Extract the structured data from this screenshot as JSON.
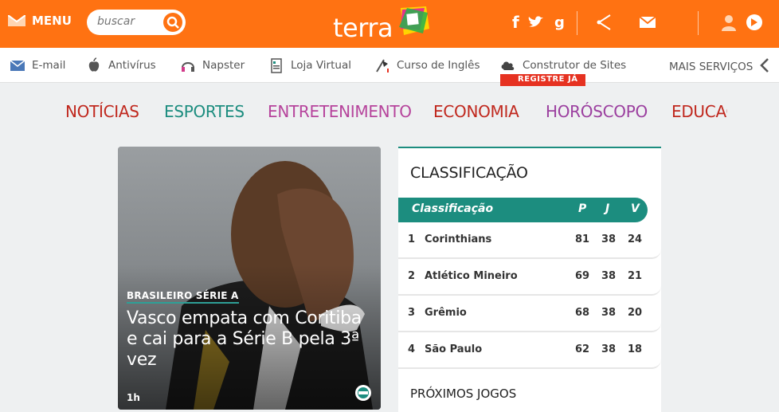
{
  "header": {
    "menu_label": "MENU",
    "search_placeholder": "buscar",
    "logo_text": "terra",
    "icons": [
      "facebook-icon",
      "twitter-icon",
      "google-plus-icon",
      "share-icon",
      "mail-icon",
      "user-icon",
      "chat-icon"
    ],
    "brand_color": "#ff7212"
  },
  "services": {
    "items": [
      {
        "label": "E-mail",
        "icon": "email-icon"
      },
      {
        "label": "Antivírus",
        "icon": "apple-icon"
      },
      {
        "label": "Napster",
        "icon": "headphones-icon"
      },
      {
        "label": "Loja Virtual",
        "icon": "store-icon"
      },
      {
        "label": "Curso de Inglês",
        "icon": "flag-icon"
      },
      {
        "label": "Construtor de Sites",
        "icon": "builder-icon"
      }
    ],
    "badge": "REGISTRE JÁ",
    "more_label": "MAIS SERVIÇOS"
  },
  "categories": [
    {
      "label": "NOTÍCIAS",
      "color": "#c0281e"
    },
    {
      "label": "ESPORTES",
      "color": "#1c8d7f"
    },
    {
      "label": "ENTRETENIMENTO",
      "color": "#b6449c"
    },
    {
      "label": "ECONOMIA",
      "color": "#c0281e"
    },
    {
      "label": "HORÓSCOPO",
      "color": "#9b3f9f"
    },
    {
      "label": "EDUCAÇ",
      "color": "#c0281e"
    }
  ],
  "hero": {
    "kicker": "BRASILEIRO SÉRIE A",
    "title": "Vasco empata com Coritiba e cai para a Série B pela 3ª vez",
    "time": "1h"
  },
  "standings": {
    "title": "CLASSIFICAÇÃO",
    "head": {
      "name": "Classificação",
      "p": "P",
      "j": "J",
      "v": "V"
    },
    "rows": [
      {
        "pos": "1",
        "team": "Corinthians",
        "p": "81",
        "j": "38",
        "v": "24"
      },
      {
        "pos": "2",
        "team": "Atlético Mineiro",
        "p": "69",
        "j": "38",
        "v": "21"
      },
      {
        "pos": "3",
        "team": "Grêmio",
        "p": "68",
        "j": "38",
        "v": "20"
      },
      {
        "pos": "4",
        "team": "São Paulo",
        "p": "62",
        "j": "38",
        "v": "18"
      }
    ],
    "next_games": "PRÓXIMOS JOGOS"
  }
}
